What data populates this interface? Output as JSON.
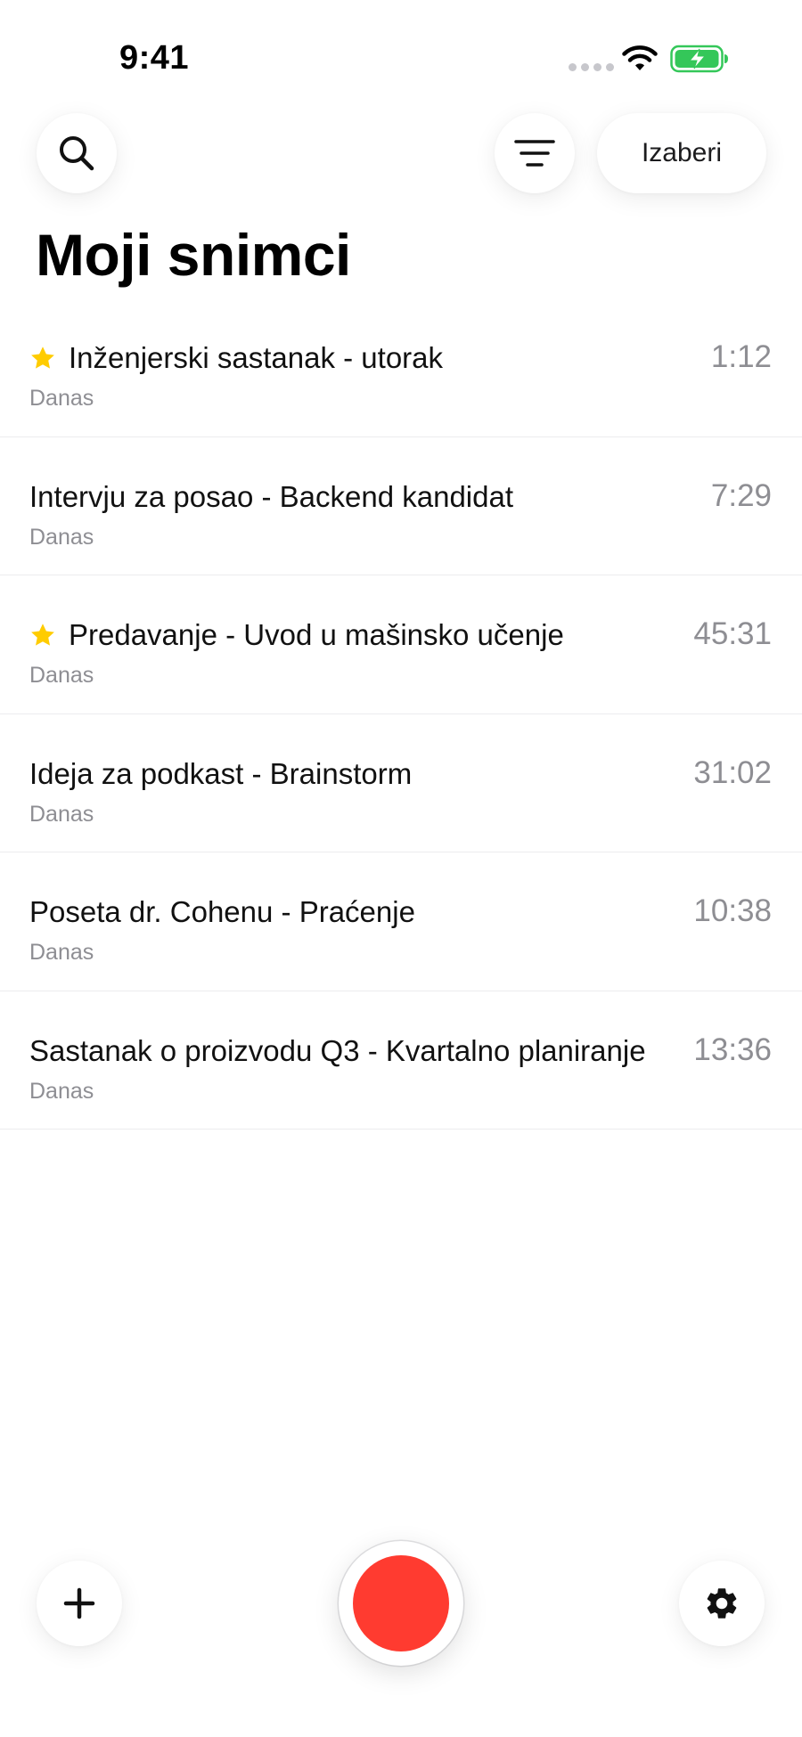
{
  "status_bar": {
    "time": "9:41"
  },
  "header": {
    "select_label": "Izaberi",
    "search_icon": "search-icon",
    "filter_icon": "filter-icon"
  },
  "page_title": "Moji snimci",
  "recordings": [
    {
      "title": "Inženjerski sastanak - utorak",
      "date": "Danas",
      "duration": "1:12",
      "starred": true
    },
    {
      "title": "Intervju za posao - Backend kandidat",
      "date": "Danas",
      "duration": "7:29",
      "starred": false
    },
    {
      "title": "Predavanje - Uvod u mašinsko učenje",
      "date": "Danas",
      "duration": "45:31",
      "starred": true
    },
    {
      "title": "Ideja za podkast - Brainstorm",
      "date": "Danas",
      "duration": "31:02",
      "starred": false
    },
    {
      "title": "Poseta dr. Cohenu - Praćenje",
      "date": "Danas",
      "duration": "10:38",
      "starred": false
    },
    {
      "title": "Sastanak o proizvodu Q3 - Kvartalno planiranje",
      "date": "Danas",
      "duration": "13:36",
      "starred": false
    }
  ],
  "bottom_bar": {
    "add_icon": "plus-icon",
    "record_icon": "record-icon",
    "settings_icon": "gear-icon"
  },
  "colors": {
    "record": "#ff3b30",
    "star": "#ffcc00",
    "battery": "#34c759",
    "secondary_text": "#8e8e93"
  }
}
